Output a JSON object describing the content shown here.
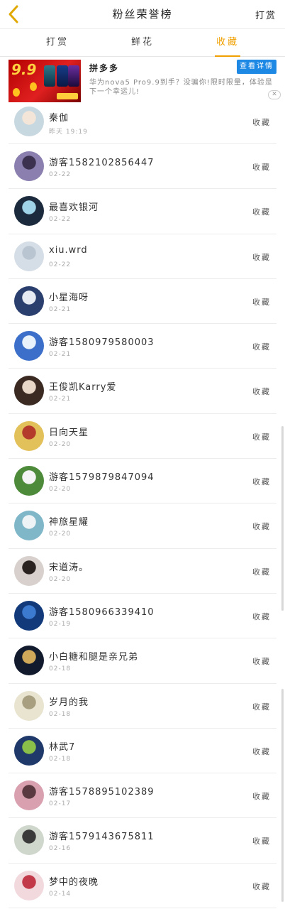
{
  "header": {
    "title": "粉丝荣誉榜",
    "right_link": "打赏",
    "back_icon": "chevron-left-icon",
    "accent_color": "#f0a000"
  },
  "tabs": [
    {
      "label": "打赏",
      "active": false
    },
    {
      "label": "鲜花",
      "active": false
    },
    {
      "label": "收藏",
      "active": true
    }
  ],
  "ad": {
    "image_text": "9.9",
    "brand": "拼多多",
    "button_label": "查看详情",
    "description": "华为nova5 Pro9.9到手？没骗你!限时限量，体验是下一个幸运儿!",
    "close_label": "✕"
  },
  "list": [
    {
      "name": "秦伽",
      "date": "昨天 19:19",
      "type": "收藏",
      "avatar_colors": [
        "#c8d8e0",
        "#f3e6d8"
      ]
    },
    {
      "name": "游客15821028564​47",
      "date": "02-22",
      "type": "收藏",
      "avatar_colors": [
        "#8a7fae",
        "#3c3250"
      ]
    },
    {
      "name": "最喜欢银河",
      "date": "02-22",
      "type": "收藏",
      "avatar_colors": [
        "#1b2a3c",
        "#9fd3e8"
      ]
    },
    {
      "name": "xiu.wrd",
      "date": "02-22",
      "type": "收藏",
      "avatar_colors": [
        "#d5dde6",
        "#b9c6d2"
      ]
    },
    {
      "name": "小星海呀",
      "date": "02-21",
      "type": "收藏",
      "avatar_colors": [
        "#2b3f6e",
        "#e6eaf2"
      ]
    },
    {
      "name": "游客1580979580003",
      "date": "02-21",
      "type": "收藏",
      "avatar_colors": [
        "#3b6fc9",
        "#e9f1fb"
      ]
    },
    {
      "name": "王俊凯Karry爱",
      "date": "02-21",
      "type": "收藏",
      "avatar_colors": [
        "#3a2a22",
        "#e8d6c6"
      ]
    },
    {
      "name": "日向天星",
      "date": "02-20",
      "type": "收藏",
      "avatar_colors": [
        "#e3c15a",
        "#b43a2c"
      ]
    },
    {
      "name": "游客1579879847094",
      "date": "02-20",
      "type": "收藏",
      "avatar_colors": [
        "#4d8a3a",
        "#f4f4f4"
      ]
    },
    {
      "name": "神旅星耀",
      "date": "02-20",
      "type": "收藏",
      "avatar_colors": [
        "#7fb7c9",
        "#eef4f5"
      ]
    },
    {
      "name": "宋道涛。",
      "date": "02-20",
      "type": "收藏",
      "avatar_colors": [
        "#d8d0cc",
        "#2a2220"
      ]
    },
    {
      "name": "游客1580966339410",
      "date": "02-19",
      "type": "收藏",
      "avatar_colors": [
        "#123a7a",
        "#3c7ad0"
      ]
    },
    {
      "name": "小白糖和腿是亲兄弟",
      "date": "02-18",
      "type": "收藏",
      "avatar_colors": [
        "#121a2e",
        "#d0a85a"
      ]
    },
    {
      "name": "岁月的我",
      "date": "02-18",
      "type": "收藏",
      "avatar_colors": [
        "#e8e4d0",
        "#a89f80"
      ]
    },
    {
      "name": "林武7",
      "date": "02-18",
      "type": "收藏",
      "avatar_colors": [
        "#1f3a6a",
        "#8ac04a"
      ]
    },
    {
      "name": "游客1578895102389",
      "date": "02-17",
      "type": "收藏",
      "avatar_colors": [
        "#d9a0b0",
        "#5a3a40"
      ]
    },
    {
      "name": "游客1579143675811",
      "date": "02-16",
      "type": "收藏",
      "avatar_colors": [
        "#cfd7cc",
        "#3a3a3a"
      ]
    },
    {
      "name": "梦中的夜晚",
      "date": "02-14",
      "type": "收藏",
      "avatar_colors": [
        "#f2d9de",
        "#c23a4a"
      ]
    }
  ]
}
